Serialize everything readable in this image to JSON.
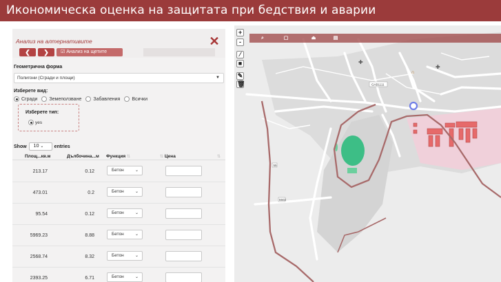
{
  "header": {
    "title": "Икономическа оценка на защитата при бедствия и аварии"
  },
  "panel": {
    "title": "Анализ на алтернативите",
    "prev_label": "❮",
    "next_label": "❯",
    "analyze_button_label": "☑ Анализ на щетите",
    "geometry_label": "Геометрична форма",
    "geometry_value": "Полигони (Сгради и площи)",
    "choose_view_label": "Изберете вид:",
    "view_options": [
      {
        "label": "Сгради",
        "selected": true
      },
      {
        "label": "Земеползване",
        "selected": false
      },
      {
        "label": "Забавления",
        "selected": false
      },
      {
        "label": "Всички",
        "selected": false
      }
    ],
    "choose_type_label": "Изберете тип:",
    "type_option": "yes",
    "show_label": "Show",
    "show_value": "10",
    "entries_label": "entries"
  },
  "table": {
    "columns": [
      "Площ...кв.м",
      "Дълбочина...м",
      "Функция",
      "Цена"
    ],
    "rows": [
      {
        "area": "213.17",
        "depth": "0.12",
        "function": "Бетон"
      },
      {
        "area": "473.01",
        "depth": "0.2",
        "function": "Бетон"
      },
      {
        "area": "95.54",
        "depth": "0.12",
        "function": "Бетон"
      },
      {
        "area": "5969.23",
        "depth": "8.88",
        "function": "Бетон"
      },
      {
        "area": "2568.74",
        "depth": "8.32",
        "function": "Бетон"
      },
      {
        "area": "2393.25",
        "depth": "6.71",
        "function": "Бетон"
      }
    ]
  },
  "map": {
    "zoom_in": "+",
    "zoom_out": "-",
    "labels": {
      "road_code": "GAB1111",
      "route_a": "55",
      "route_b": "5502"
    }
  },
  "colors": {
    "brand": "#9b3b3b",
    "accent_button": "#b34343",
    "stadium": "#3dbe86",
    "river": "#a86a6a",
    "buildings": "#e66a6a"
  }
}
